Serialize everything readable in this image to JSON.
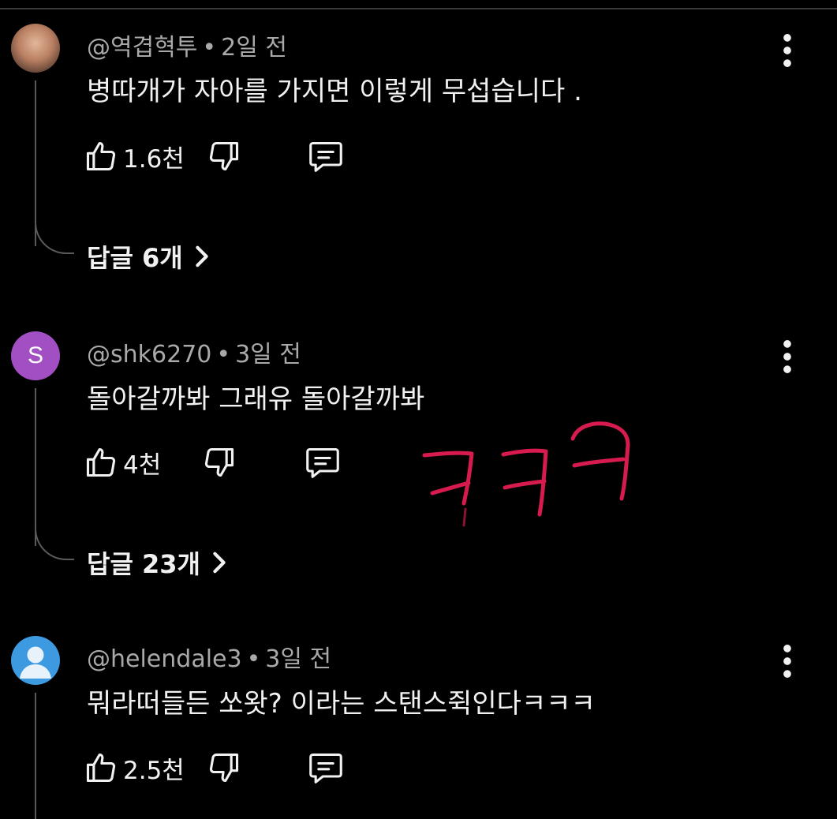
{
  "comments": [
    {
      "handle": "@역겹혁투",
      "time": "2일 전",
      "text": "병따개가 자아를 가지면 이렇게 무섭습니다 .",
      "likes": "1.6천",
      "replies": "답글 6개",
      "avatar": "photo"
    },
    {
      "handle": "@shk6270",
      "time": "3일 전",
      "text": "돌아갈까봐 그래유 돌아갈까봐",
      "likes": "4천",
      "replies": "답글 23개",
      "avatar": "S"
    },
    {
      "handle": "@helendale3",
      "time": "3일 전",
      "text": "뭐라떠들든 쏘왓? 이라는 스탠스쥑인다ㅋㅋㅋ",
      "likes": "2.5천",
      "avatar": "default-person"
    }
  ],
  "separator": "•",
  "colors": {
    "background": "#000000",
    "scribble": "#d81b4f",
    "avatar_s": "#a24fc4",
    "avatar_default": "#3d9ae0"
  },
  "icons": [
    "thumb-up-icon",
    "thumb-down-icon",
    "reply-comment-icon",
    "more-vert-icon",
    "chevron-right-icon"
  ]
}
